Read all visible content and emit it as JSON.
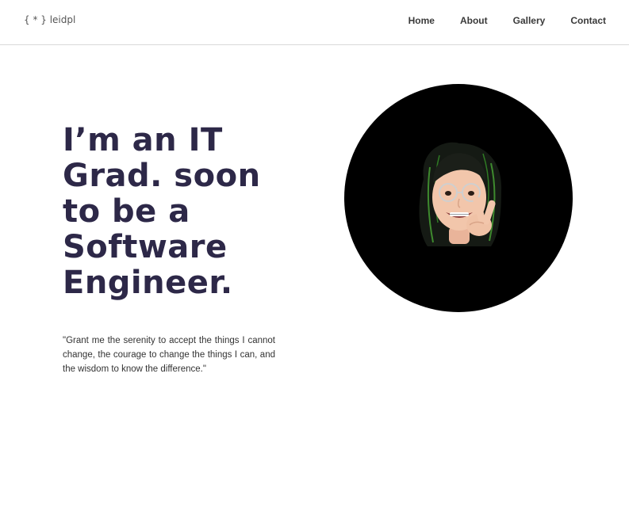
{
  "header": {
    "logo": "{ * } leidpl",
    "nav": [
      {
        "label": "Home"
      },
      {
        "label": "About"
      },
      {
        "label": "Gallery"
      },
      {
        "label": "Contact"
      }
    ]
  },
  "hero": {
    "headline_lines": [
      "I’m an IT",
      "Grad. soon",
      "to be a",
      "Software",
      "Engineer."
    ],
    "quote": "\"Grant me the serenity to accept the things I cannot change, the courage to change the things I can, and the wisdom to know the difference.\""
  },
  "avatar": {
    "icon": "memoji-avatar-icon",
    "background_color": "#000000"
  },
  "colors": {
    "headline": "#2d2848",
    "nav_text": "#3a3a3a",
    "divider": "#d9d9d9"
  }
}
